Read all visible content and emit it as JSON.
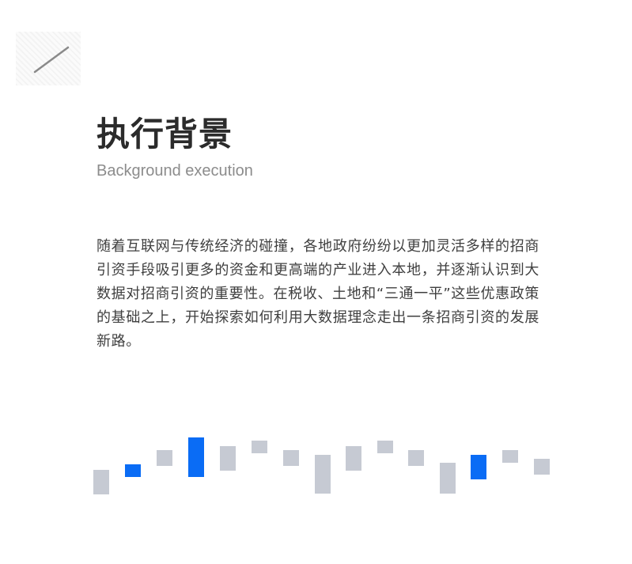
{
  "header": {
    "title": "执行背景",
    "subtitle": "Background execution"
  },
  "content": {
    "paragraph": "随着互联网与传统经济的碰撞，各地政府纷纷以更加灵活多样的招商引资手段吸引更多的资金和更高端的产业进入本地，并逐渐认识到大数据对招商引资的重要性。在税收、土地和“三通一平”这些优惠政策的基础之上，开始探索如何利用大数据理念走出一条招商引资的发展新路。"
  },
  "colors": {
    "accent": "#0a6cf5",
    "neutral": "#c6cad3"
  },
  "icons": {
    "corner": "diagonal-line-icon"
  }
}
